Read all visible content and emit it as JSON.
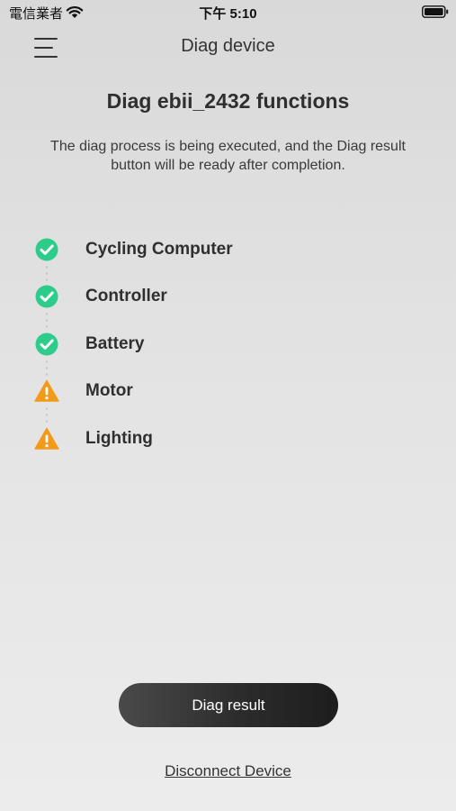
{
  "status_bar": {
    "carrier": "電信業者",
    "time": "下午 5:10"
  },
  "nav": {
    "title": "Diag device",
    "menu_icon": "hamburger-menu-icon"
  },
  "heading": "Diag ebii_2432 functions",
  "description": "The diag process is being executed, and the Diag result button will be ready after completion.",
  "functions": [
    {
      "label": "Cycling Computer",
      "status": "ok",
      "icon": "check-circle-icon"
    },
    {
      "label": "Controller",
      "status": "ok",
      "icon": "check-circle-icon"
    },
    {
      "label": "Battery",
      "status": "ok",
      "icon": "check-circle-icon"
    },
    {
      "label": "Motor",
      "status": "warning",
      "icon": "warning-triangle-icon"
    },
    {
      "label": "Lighting",
      "status": "warning",
      "icon": "warning-triangle-icon"
    }
  ],
  "colors": {
    "ok": "#2ecc8a",
    "warning": "#f39a1a"
  },
  "buttons": {
    "result": "Diag result",
    "disconnect": "Disconnect Device"
  }
}
